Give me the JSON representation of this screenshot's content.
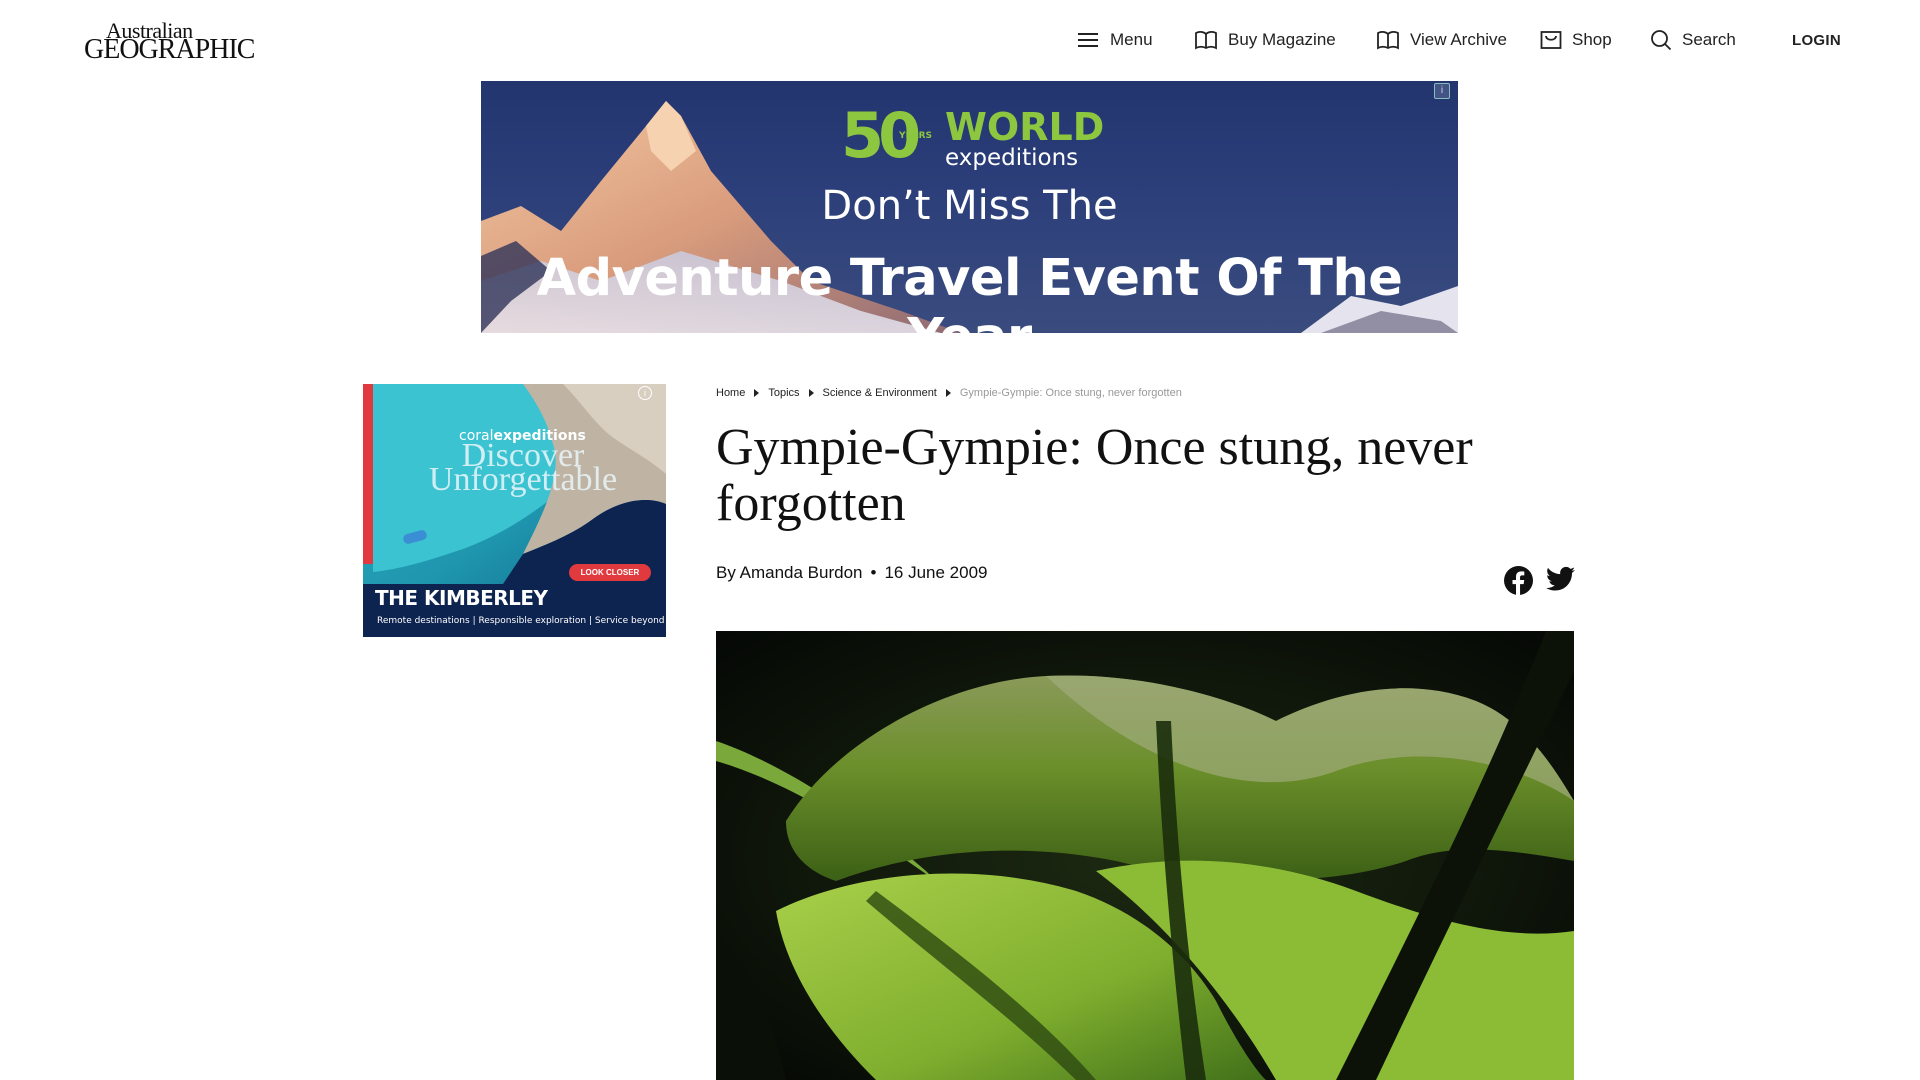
{
  "header": {
    "logo": {
      "line1": "Australian",
      "line2": "GEOGRAPHIC"
    },
    "nav": {
      "menu": "Menu",
      "buy_magazine": "Buy Magazine",
      "view_archive": "View Archive",
      "shop": "Shop",
      "search": "Search",
      "login": "LOGIN"
    }
  },
  "top_ad": {
    "logo_number": "50",
    "logo_years": "YEARS",
    "logo_world": "WORLD",
    "logo_expeditions": "expeditions",
    "headline": "Don’t Miss The",
    "subheadline": "Adventure Travel Event Of The Year",
    "info": "i"
  },
  "side_ad": {
    "brand_prefix": "coral",
    "brand_suffix": "expeditions",
    "tagline": "Discover Unforgettable",
    "cta": "LOOK CLOSER",
    "destination": "THE KIMBERLEY",
    "features": "Remote destinations | Responsible exploration | Service beyond expectation",
    "info": "i"
  },
  "breadcrumb": {
    "items": [
      "Home",
      "Topics",
      "Science & Environment"
    ],
    "current": "Gympie-Gympie: Once stung, never forgotten"
  },
  "article": {
    "title": "Gympie-Gympie: Once stung, never forgotten",
    "author": "By Amanda Burdon",
    "separator": "•",
    "date": "16 June 2009"
  },
  "social": {
    "icons": [
      "facebook-icon",
      "twitter-icon"
    ]
  },
  "colors": {
    "brand_green": "#8dc63f",
    "ad_navy": "#0d2350",
    "accent_red": "#e03a3e",
    "text": "#111111"
  }
}
